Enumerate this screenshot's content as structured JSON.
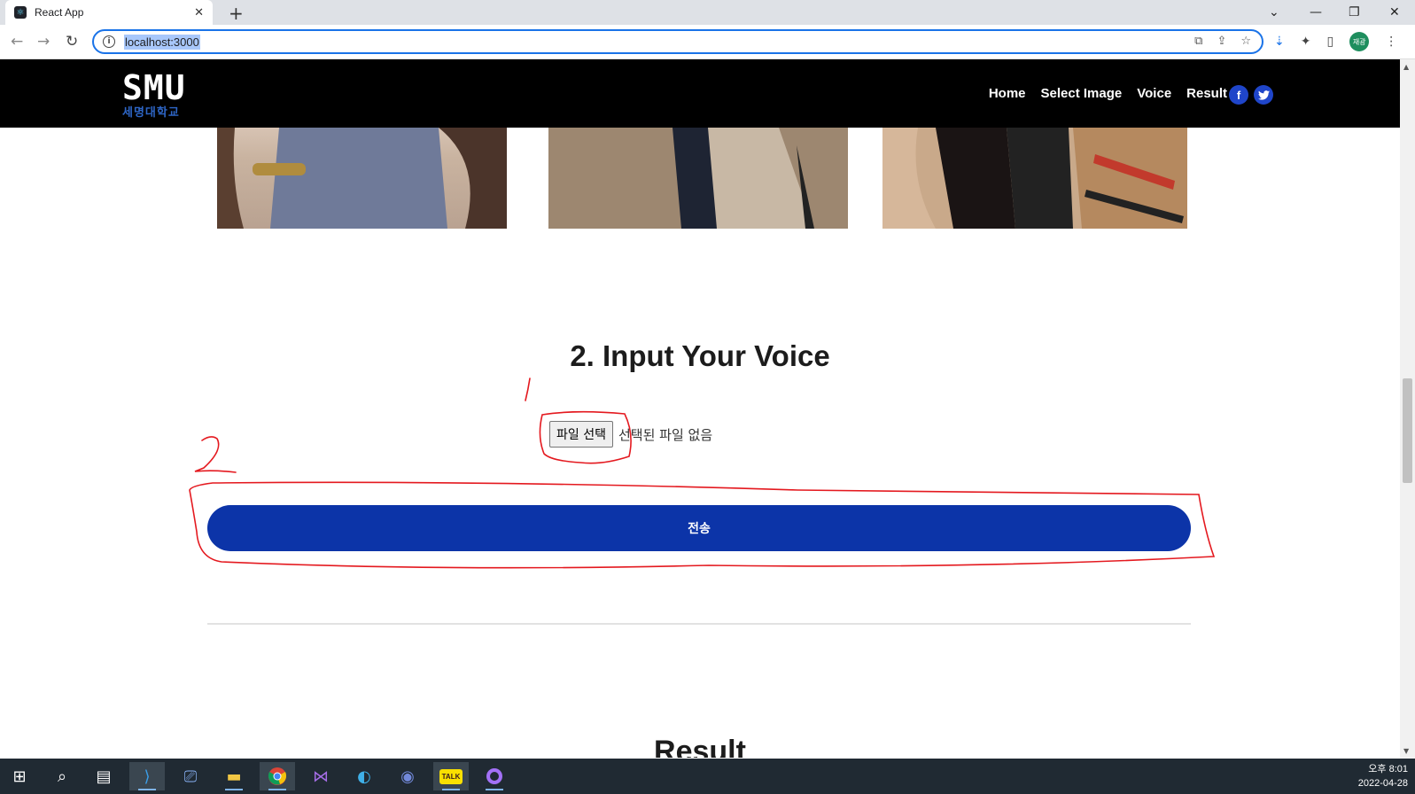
{
  "browser": {
    "tab_title": "React App",
    "url": "localhost:3000",
    "profile_initials": "재광"
  },
  "site": {
    "logo_text": "SMU",
    "logo_subtext": "세명대학교",
    "nav": [
      "Home",
      "Select Image",
      "Voice",
      "Result"
    ],
    "social": [
      "facebook",
      "twitter"
    ]
  },
  "voice_section": {
    "title": "2. Input Your Voice",
    "file_button": "파일 선택",
    "file_status": "선택된 파일 없음",
    "submit_label": "전송"
  },
  "result_section": {
    "title": "Result"
  },
  "annotations": [
    "1",
    "2"
  ],
  "taskbar": {
    "time": "오후 8:01",
    "date": "2022-04-28"
  },
  "colors": {
    "accent": "#0c34a8",
    "header_bg": "#000000",
    "annotation": "#e4191f"
  }
}
